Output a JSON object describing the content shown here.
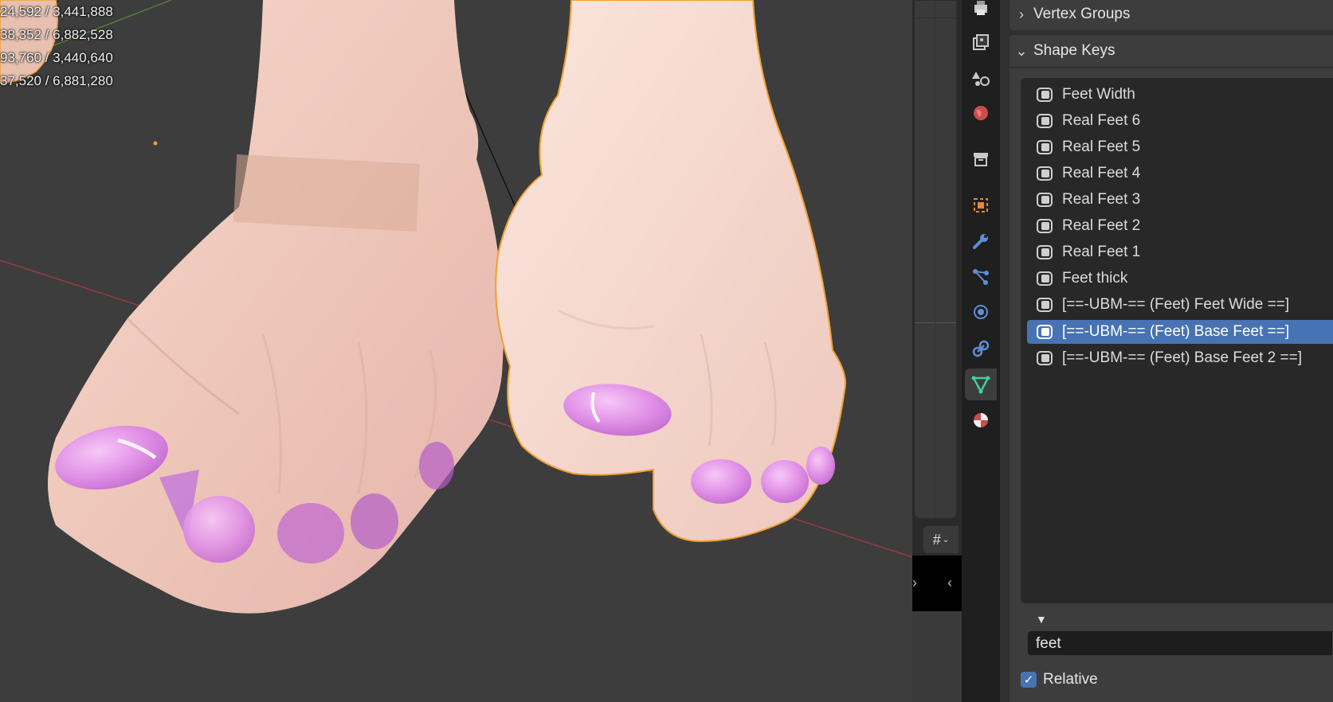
{
  "viewport": {
    "stats": [
      "24,592 / 3,441,888",
      "38,352 / 6,882,528",
      "93,760 / 3,440,640",
      "37,520 / 6,881,280"
    ]
  },
  "toolbar": {
    "nav_gizmo_icon": "grid-gizmo-icon"
  },
  "properties": {
    "tabs": [
      {
        "name": "output",
        "icon": "printer-icon"
      },
      {
        "name": "view-layer",
        "icon": "image-stack-icon"
      },
      {
        "name": "scene",
        "icon": "scene-icon"
      },
      {
        "name": "world",
        "icon": "globe-icon"
      },
      {
        "name": "collection",
        "icon": "box-icon"
      },
      {
        "name": "object",
        "icon": "object-square-icon"
      },
      {
        "name": "modifiers",
        "icon": "wrench-icon"
      },
      {
        "name": "particles",
        "icon": "particles-icon"
      },
      {
        "name": "physics",
        "icon": "physics-orbit-icon"
      },
      {
        "name": "constraints",
        "icon": "constraint-icon"
      },
      {
        "name": "data",
        "icon": "mesh-triangle-icon",
        "active": true
      },
      {
        "name": "material",
        "icon": "material-sphere-icon"
      }
    ],
    "vertex_groups": {
      "label": "Vertex Groups",
      "collapsed": true
    },
    "shape_keys": {
      "label": "Shape Keys",
      "items": [
        {
          "label": "Feet Width"
        },
        {
          "label": "Real Feet 6"
        },
        {
          "label": "Real Feet 5"
        },
        {
          "label": "Real Feet 4"
        },
        {
          "label": "Real Feet 3"
        },
        {
          "label": "Real Feet 2"
        },
        {
          "label": "Real Feet 1"
        },
        {
          "label": "Feet thick"
        },
        {
          "label": "[==-UBM-== (Feet) Feet Wide ==]"
        },
        {
          "label": "[==-UBM-== (Feet) Base Feet ==]",
          "selected": true
        },
        {
          "label": "[==-UBM-== (Feet) Base Feet 2 ==]"
        }
      ],
      "filter_value": "feet",
      "relative_label": "Relative",
      "relative_checked": true
    }
  },
  "colors": {
    "accent": "#4772b3",
    "viewport_bg": "#3d3d3d",
    "selection_outline": "#f0a030",
    "nail_polish": "#e08fe6"
  }
}
